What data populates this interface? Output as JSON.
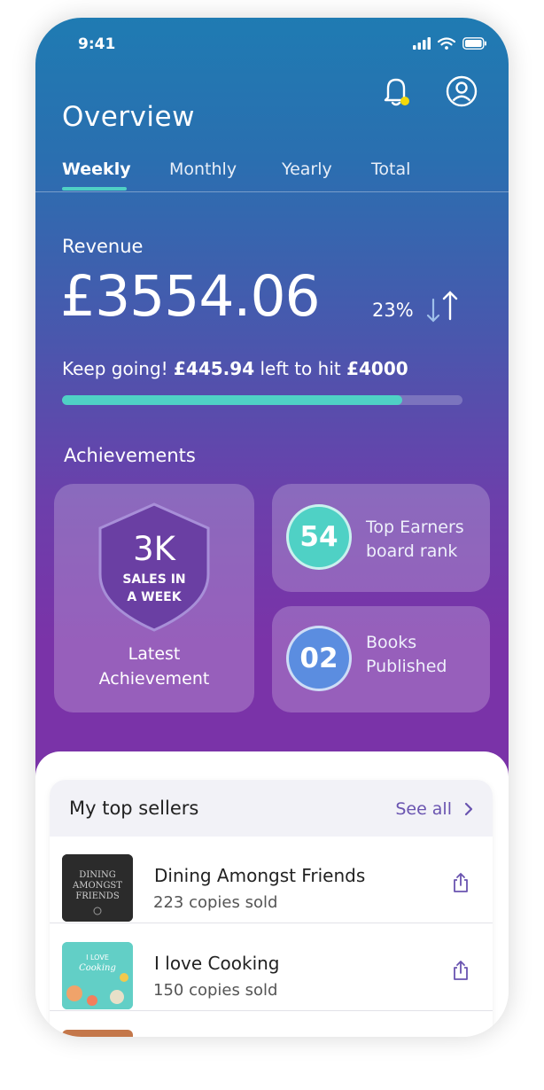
{
  "status_bar": {
    "time": "9:41"
  },
  "header": {
    "title": "Overview"
  },
  "tabs": [
    {
      "label": "Weekly",
      "active": true
    },
    {
      "label": "Monthly",
      "active": false
    },
    {
      "label": "Yearly",
      "active": false
    },
    {
      "label": "Total",
      "active": false
    }
  ],
  "revenue": {
    "label": "Revenue",
    "amount": "£3554.06",
    "change": "23%",
    "keep_prefix": "Keep going! ",
    "left_amount": "£445.94",
    "keep_middle": " left to hit ",
    "target": "£4000",
    "progress_fraction": 0.85
  },
  "achievements": {
    "title": "Achievements",
    "latest": {
      "number": "3K",
      "sub_line1": "SALES IN",
      "sub_line2": "A WEEK",
      "label_line1": "Latest",
      "label_line2": "Achievement"
    },
    "rank": {
      "value": "54",
      "label_line1": "Top Earners",
      "label_line2": "board rank"
    },
    "books": {
      "value": "02",
      "label_line1": "Books",
      "label_line2": "Published"
    }
  },
  "top_sellers": {
    "title": "My top sellers",
    "see_all": "See all",
    "items": [
      {
        "title": "Dining Amongst Friends",
        "sold": "223 copies sold",
        "cover_text_line1": "DINING",
        "cover_text_line2": "AMONGST",
        "cover_text_line3": "FRIENDS"
      },
      {
        "title": "I love Cooking",
        "sold": "150 copies sold",
        "cover_text_line1": "I LOVE",
        "cover_text_line2": "Cooking"
      }
    ]
  },
  "colors": {
    "accent": "#4fd1c5",
    "gradient_top": "#1f7bb2",
    "gradient_bottom": "#7a33a8",
    "link": "#6a54b0",
    "rank_circle": "#4fd1c5",
    "books_circle": "#5b8de0",
    "notification_dot": "#f5d90a"
  },
  "icons": [
    "signal-icon",
    "wifi-icon",
    "battery-icon",
    "bell-icon",
    "profile-icon",
    "arrows-icon",
    "shield-icon",
    "chevron-right-icon",
    "share-icon"
  ]
}
